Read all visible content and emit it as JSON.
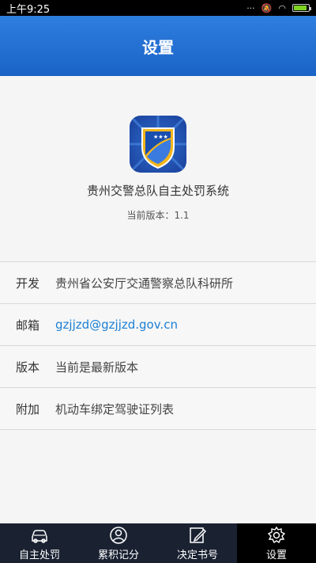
{
  "status_bar": {
    "time": "上午9:25",
    "battery_level": 0.9
  },
  "header": {
    "title": "设置"
  },
  "about": {
    "logo_icon": "police-shield-icon",
    "app_name": "贵州交警总队自主处罚系统",
    "version_text": "当前版本：1.1"
  },
  "info": {
    "rows": [
      {
        "label": "开发",
        "value": "贵州省公安厅交通警察总队科研所"
      },
      {
        "label": "邮箱",
        "value": "gzjjzd@gzjjzd.gov.cn"
      },
      {
        "label": "版本",
        "value": "当前是最新版本"
      },
      {
        "label": "附加",
        "value": "机动车绑定驾驶证列表"
      }
    ]
  },
  "tabs": [
    {
      "label": "自主处罚",
      "icon": "car-icon",
      "active": false
    },
    {
      "label": "累积记分",
      "icon": "user-icon",
      "active": false
    },
    {
      "label": "决定书号",
      "icon": "edit-icon",
      "active": false
    },
    {
      "label": "设置",
      "icon": "gear-icon",
      "active": true
    }
  ],
  "colors": {
    "header": "#1a63c6",
    "link": "#1a7fd4",
    "tab_bar": "#1a2232"
  }
}
